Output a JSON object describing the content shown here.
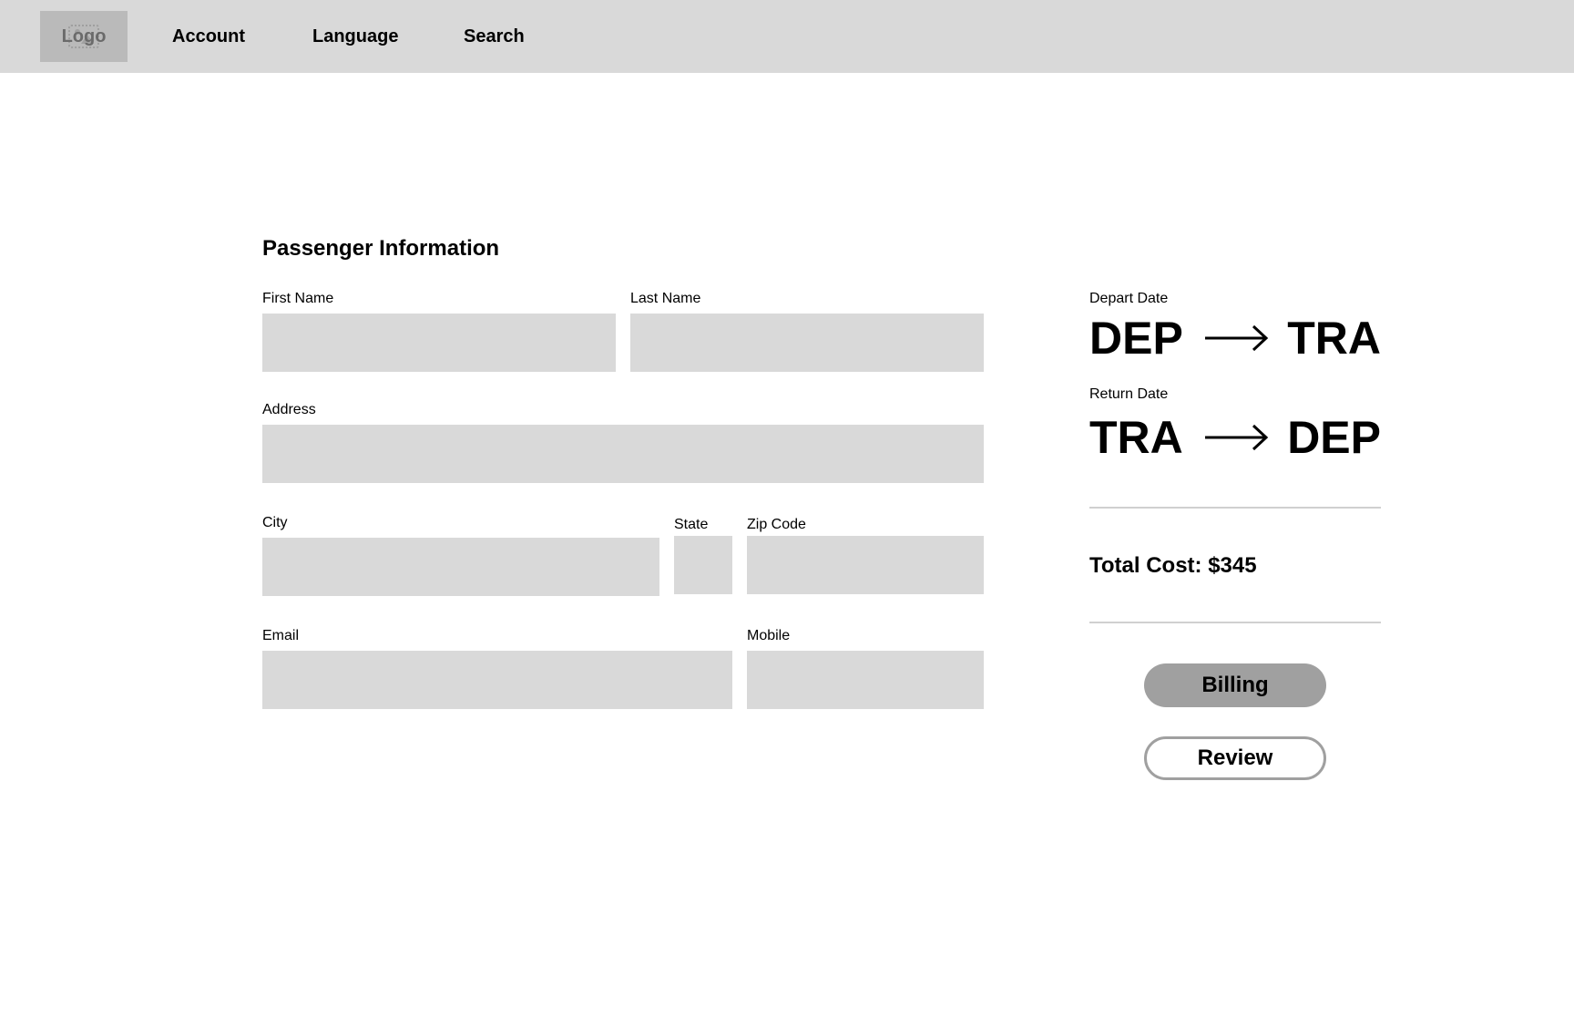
{
  "header": {
    "logo_label": "Logo",
    "logo_icon": "image-placeholder-icon",
    "nav": [
      {
        "label": "Account"
      },
      {
        "label": "Language"
      },
      {
        "label": "Search"
      }
    ]
  },
  "form": {
    "title": "Passenger Information",
    "fields": {
      "first_name": {
        "label": "First Name",
        "value": ""
      },
      "last_name": {
        "label": "Last Name",
        "value": ""
      },
      "address": {
        "label": "Address",
        "value": ""
      },
      "city": {
        "label": "City",
        "value": ""
      },
      "state": {
        "label": "State",
        "value": ""
      },
      "zip": {
        "label": "Zip Code",
        "value": ""
      },
      "email": {
        "label": "Email",
        "value": ""
      },
      "mobile": {
        "label": "Mobile",
        "value": ""
      }
    }
  },
  "summary": {
    "depart": {
      "label": "Depart Date",
      "from": "DEP",
      "to": "TRA",
      "arrow_icon": "long-arrow-right-icon"
    },
    "return": {
      "label": "Return Date",
      "from": "TRA",
      "to": "DEP",
      "arrow_icon": "long-arrow-right-icon"
    },
    "total_cost": "Total Cost: $345",
    "buttons": {
      "billing": "Billing",
      "review": "Review"
    }
  },
  "colors": {
    "header_bg": "#d9d9d9",
    "logo_bg": "#bababa",
    "input_bg": "#d9d9d9",
    "primary_button": "#a0a0a0",
    "divider": "#d0d0d0"
  }
}
